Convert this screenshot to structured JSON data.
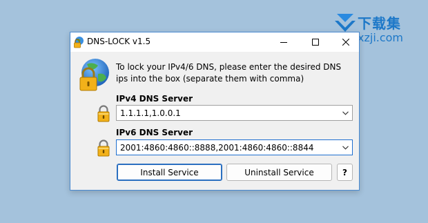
{
  "watermark": {
    "brand_cn": "下载集",
    "url": "xzji.com"
  },
  "window": {
    "title": "DNS-LOCK v1.5",
    "controls": {
      "minimize_icon": "minimize-icon",
      "maximize_icon": "maximize-icon",
      "close_icon": "close-icon"
    }
  },
  "main": {
    "description": "To lock your IPv4/6 DNS, please enter the desired DNS ips into the box (separate them with comma)",
    "ipv4": {
      "label": "IPv4 DNS Server",
      "value": "1.1.1.1,1.0.0.1"
    },
    "ipv6": {
      "label": "IPv6 DNS Server",
      "value": "2001:4860:4860::8888,2001:4860:4860::8844"
    }
  },
  "buttons": {
    "install": "Install Service",
    "uninstall": "Uninstall Service",
    "help": "?"
  },
  "colors": {
    "accent": "#1e6fd0",
    "desktop": "#a4c2dc",
    "lock": "#f2b11a",
    "watermark": "#1d78c8"
  }
}
